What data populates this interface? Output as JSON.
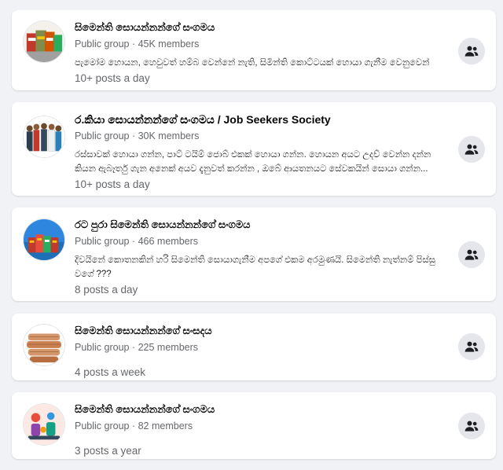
{
  "groups": [
    {
      "name": "සිමෙන්ති සොයන්නන්ගේ සංගමය",
      "meta": "Public group · 45K members",
      "description": "පැමෝම හොයන, හෙවුවත් හම්බ වෙන්නේ නැති, සිමින්ති කොට්ටයක් හොයා ගැනීම වෙනුවෙන්",
      "frequency": "10+ posts a day",
      "avatar": "cement-bags-avatar"
    },
    {
      "name": "ර.කියා සොයන්නන්ගේ සංගමය / Job Seekers Society",
      "meta": "Public group · 30K members",
      "description": "රස්සාවක් හොයා ගන්න, පාට් ටයිම් ජොබ් එකක් හොයා ගන්න. හොයන අයට උදව් වෙන්න දන්න කියන ඇබෑර්තු ගැන අනෙක් අයව දැනුවත් කරන්න , ඔබේ ආයතනයට සේවකයින් සොයා ගන්න...",
      "frequency": "10+ posts a day",
      "avatar": "people-group-avatar"
    },
    {
      "name": "රට පුරා සිමෙන්ති සොයන්නන්ගේ සංගමය",
      "meta": "Public group · 466 members",
      "description": "දිවයිනේ කොතනකින් හරි සිමෙන්ති සොයාගැනීම අපගේ එකම අරමුණයි. සිමෙන්ති නැත්නම් පිස්සු වගේ ???",
      "frequency": "8 posts a day",
      "avatar": "cement-globe-avatar"
    },
    {
      "name": "සිමෙන්ති සොයන්නන්ගේ සංසදය",
      "meta": "Public group · 225 members",
      "description": "",
      "frequency": "4 posts a week",
      "avatar": "cement-stack-avatar"
    },
    {
      "name": "සිමෙන්ති සොයන්නන්ගේ සංගමය",
      "meta": "Public group · 82 members",
      "description": "",
      "frequency": "3 posts a year",
      "avatar": "illustration-avatar"
    }
  ],
  "icons": {
    "join": "join-group-icon"
  },
  "colors": {
    "background": "#f0f2f5",
    "card": "#ffffff",
    "secondary_text": "#65676b",
    "button": "#e4e6eb"
  }
}
